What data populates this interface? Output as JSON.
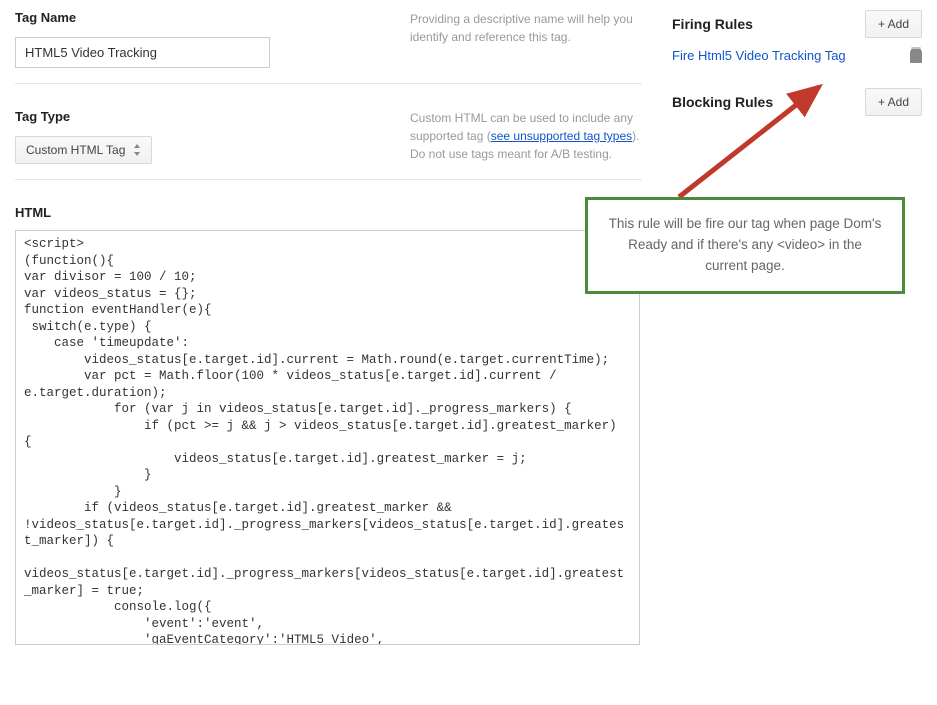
{
  "tagName": {
    "label": "Tag Name",
    "value": "HTML5 Video Tracking",
    "help": "Providing a descriptive name will help you identify and reference this tag."
  },
  "tagType": {
    "label": "Tag Type",
    "value": "Custom HTML Tag",
    "helpPrefix": "Custom HTML can be used to include any supported tag (",
    "helpLink": "see unsupported tag types",
    "helpSuffix": "). Do not use tags meant for A/B testing."
  },
  "htmlLabel": "HTML",
  "code": "<script>\n(function(){\nvar divisor = 100 / 10;\nvar videos_status = {};\nfunction eventHandler(e){\n switch(e.type) {\n    case 'timeupdate':\n        videos_status[e.target.id].current = Math.round(e.target.currentTime);\n        var pct = Math.floor(100 * videos_status[e.target.id].current / e.target.duration);\n            for (var j in videos_status[e.target.id]._progress_markers) {\n                if (pct >= j && j > videos_status[e.target.id].greatest_marker) {\n                    videos_status[e.target.id].greatest_marker = j;\n                }\n            }\n        if (videos_status[e.target.id].greatest_marker && !videos_status[e.target.id]._progress_markers[videos_status[e.target.id].greatest_marker]) {\n            videos_status[e.target.id]._progress_markers[videos_status[e.target.id].greatest_marker] = true;\n            console.log({\n                'event':'event',\n                'gaEventCategory':'HTML5 Video',\n                'gaEventAction':'Progress %'+videos_status[e.target.id].greatest_marker,\n                'gaEventLabel':decodeURIComponent(e.target.currentSrc.split('/')[e.target.currentSrc.split('/').length-1])",
  "firing": {
    "title": "Firing Rules",
    "addLabel": "+ Add",
    "rule": "Fire Html5 Video Tracking Tag"
  },
  "blocking": {
    "title": "Blocking Rules",
    "addLabel": "+ Add"
  },
  "callout": "This rule will be fire our tag when page Dom's Ready and if there's any <video> in the current page."
}
